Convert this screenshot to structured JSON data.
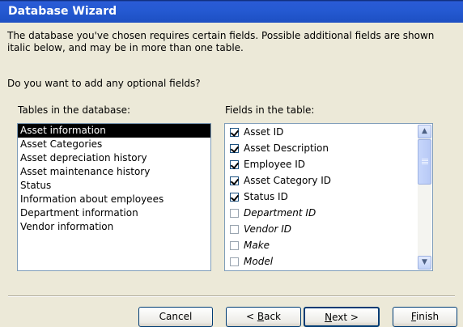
{
  "window": {
    "title": "Database Wizard"
  },
  "description": "The database you've chosen requires certain fields. Possible additional fields are shown italic below, and may be in more than one table.",
  "question": "Do you want to add any optional fields?",
  "tables": {
    "label": "Tables in the database:",
    "selected_index": 0,
    "items": [
      {
        "label": "Asset information"
      },
      {
        "label": "Asset Categories"
      },
      {
        "label": "Asset depreciation history"
      },
      {
        "label": "Asset maintenance history"
      },
      {
        "label": "Status"
      },
      {
        "label": "Information about employees"
      },
      {
        "label": "Department information"
      },
      {
        "label": "Vendor information"
      }
    ]
  },
  "fields": {
    "label": "Fields in the table:",
    "items": [
      {
        "label": "Asset ID",
        "checked": true,
        "optional": false
      },
      {
        "label": "Asset Description",
        "checked": true,
        "optional": false
      },
      {
        "label": "Employee ID",
        "checked": true,
        "optional": false
      },
      {
        "label": "Asset Category ID",
        "checked": true,
        "optional": false
      },
      {
        "label": "Status ID",
        "checked": true,
        "optional": false
      },
      {
        "label": "Department ID",
        "checked": false,
        "optional": true
      },
      {
        "label": "Vendor ID",
        "checked": false,
        "optional": true
      },
      {
        "label": "Make",
        "checked": false,
        "optional": true
      },
      {
        "label": "Model",
        "checked": false,
        "optional": true
      }
    ]
  },
  "buttons": {
    "cancel": "Cancel",
    "back_prefix": "< ",
    "back_key": "B",
    "back_rest": "ack",
    "next_key": "N",
    "next_rest": "ext >",
    "finish_key": "F",
    "finish_rest": "inish"
  }
}
